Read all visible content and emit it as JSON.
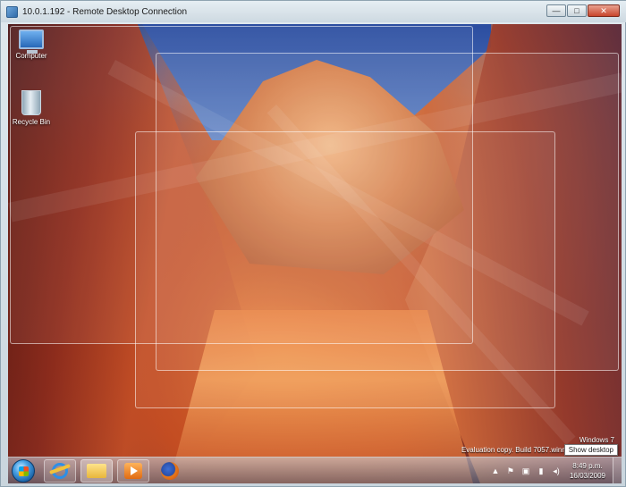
{
  "window": {
    "title": "10.0.1.192 - Remote Desktop Connection",
    "minimize": "—",
    "maximize": "□",
    "close": "✕"
  },
  "desktop": {
    "icons": [
      {
        "label": "Computer",
        "icon": "computer-icon"
      },
      {
        "label": "Recycle Bin",
        "icon": "recycle-bin-icon"
      }
    ],
    "watermark": {
      "line1": "Windows 7",
      "line2": "Evaluation copy. Build 7057.winm"
    }
  },
  "taskbar": {
    "pinned": [
      {
        "name": "internet-explorer",
        "icon": "ie-icon"
      },
      {
        "name": "windows-explorer",
        "icon": "folder-icon"
      },
      {
        "name": "windows-media-player",
        "icon": "media-player-icon"
      },
      {
        "name": "firefox",
        "icon": "firefox-icon"
      }
    ],
    "tray": {
      "time": "8:49 p.m.",
      "date": "16/03/2009"
    },
    "show_desktop_tooltip": "Show desktop"
  }
}
